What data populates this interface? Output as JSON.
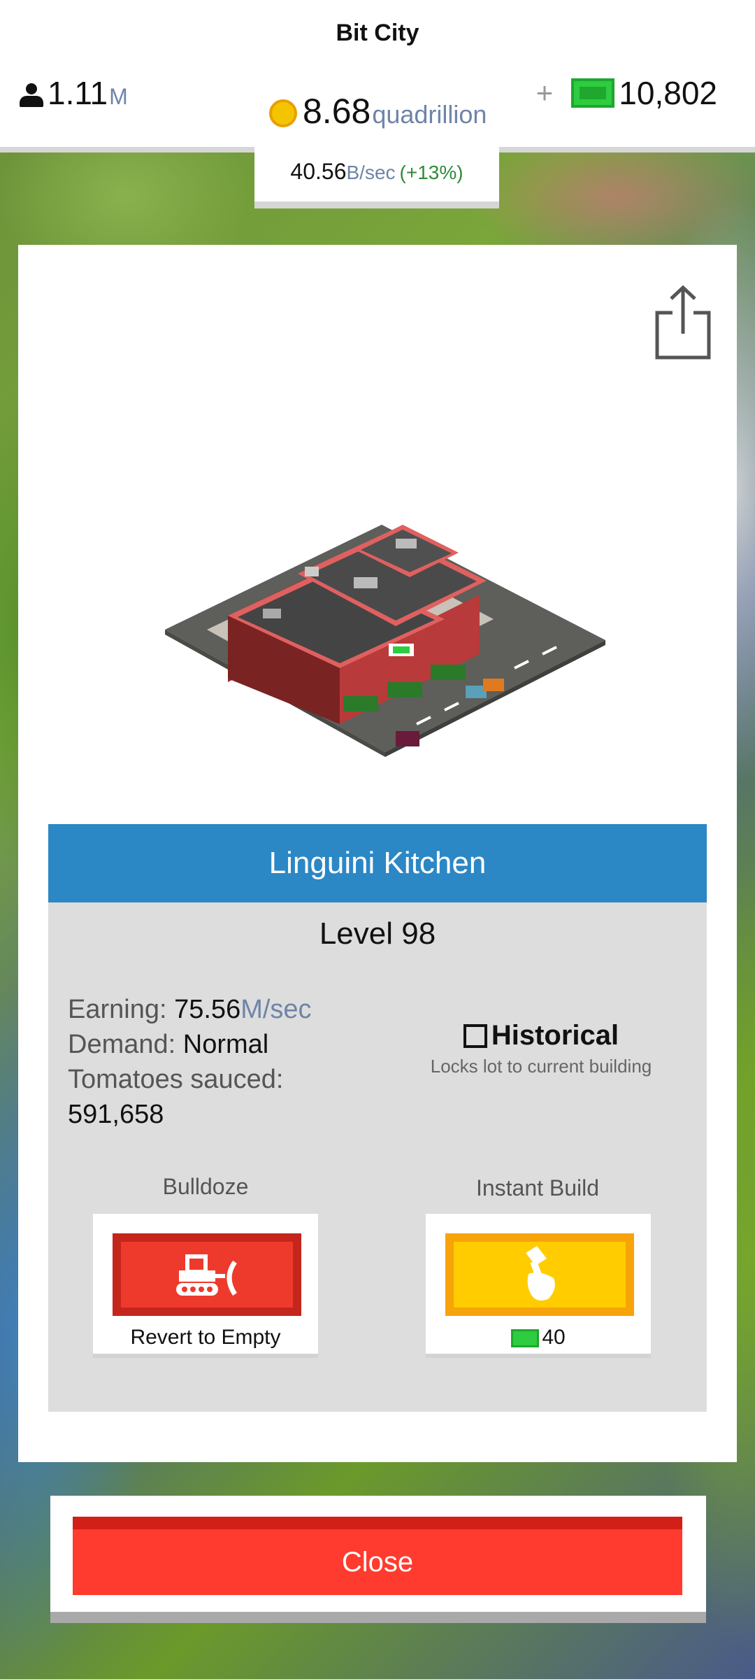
{
  "header": {
    "city_name": "Bit City",
    "population": "1.11",
    "population_unit": "M",
    "coins": "8.68",
    "coins_unit": "quadrillion",
    "plus": "+",
    "cash": "10,802",
    "income": "40.56",
    "income_unit": "B/sec",
    "income_bonus": "(+13%)"
  },
  "building": {
    "name": "Linguini Kitchen",
    "level": "Level 98",
    "earning_label": "Earning:",
    "earning_value": "75.56",
    "earning_unit": "M/sec",
    "demand_label": "Demand:",
    "demand_value": "Normal",
    "stat_label": "Tomatoes sauced:",
    "stat_value": "591,658"
  },
  "historical": {
    "label": "Historical",
    "description": "Locks lot to current building",
    "checked": false
  },
  "actions": {
    "bulldoze_label": "Bulldoze",
    "bulldoze_caption": "Revert to Empty",
    "instant_build_label": "Instant Build",
    "instant_build_cost": "40"
  },
  "close_label": "Close",
  "icons": {
    "population": "person-icon",
    "coins": "coin-icon",
    "cash": "cash-icon",
    "share": "share-icon",
    "bulldoze": "bulldozer-icon",
    "build": "hammer-hand-icon"
  },
  "colors": {
    "title_bar": "#2c87c5",
    "bulldoze": "#ee3a2d",
    "build": "#ffcc00",
    "close": "#ff3b2f",
    "cash": "#2ecc40"
  }
}
